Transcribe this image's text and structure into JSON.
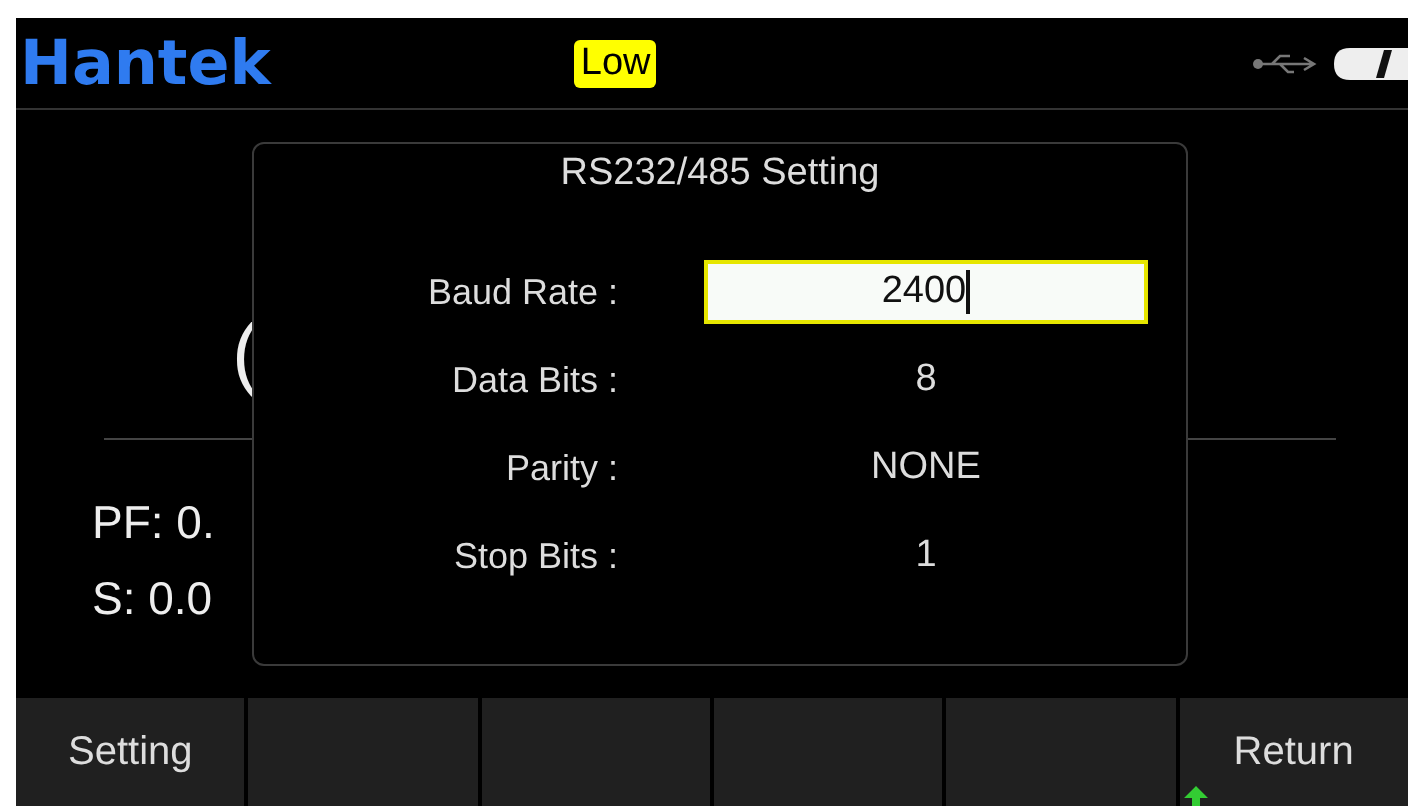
{
  "header": {
    "logo": "Hantek",
    "badge": "Low"
  },
  "background": {
    "reading_fragment": "(",
    "pf": "PF: 0.",
    "s": "S: 0.0"
  },
  "dialog": {
    "title": "RS232/485 Setting",
    "rows": [
      {
        "kind": "input",
        "label": "Baud Rate :",
        "value": "2400",
        "selected": true
      },
      {
        "kind": "value",
        "label": "Data Bits :",
        "value": "8",
        "selected": false
      },
      {
        "kind": "value",
        "label": "Parity :",
        "value": "NONE",
        "selected": false
      },
      {
        "kind": "value",
        "label": "Stop Bits :",
        "value": "1",
        "selected": false
      }
    ]
  },
  "softkeys": {
    "left": "Setting",
    "right": "Return"
  }
}
